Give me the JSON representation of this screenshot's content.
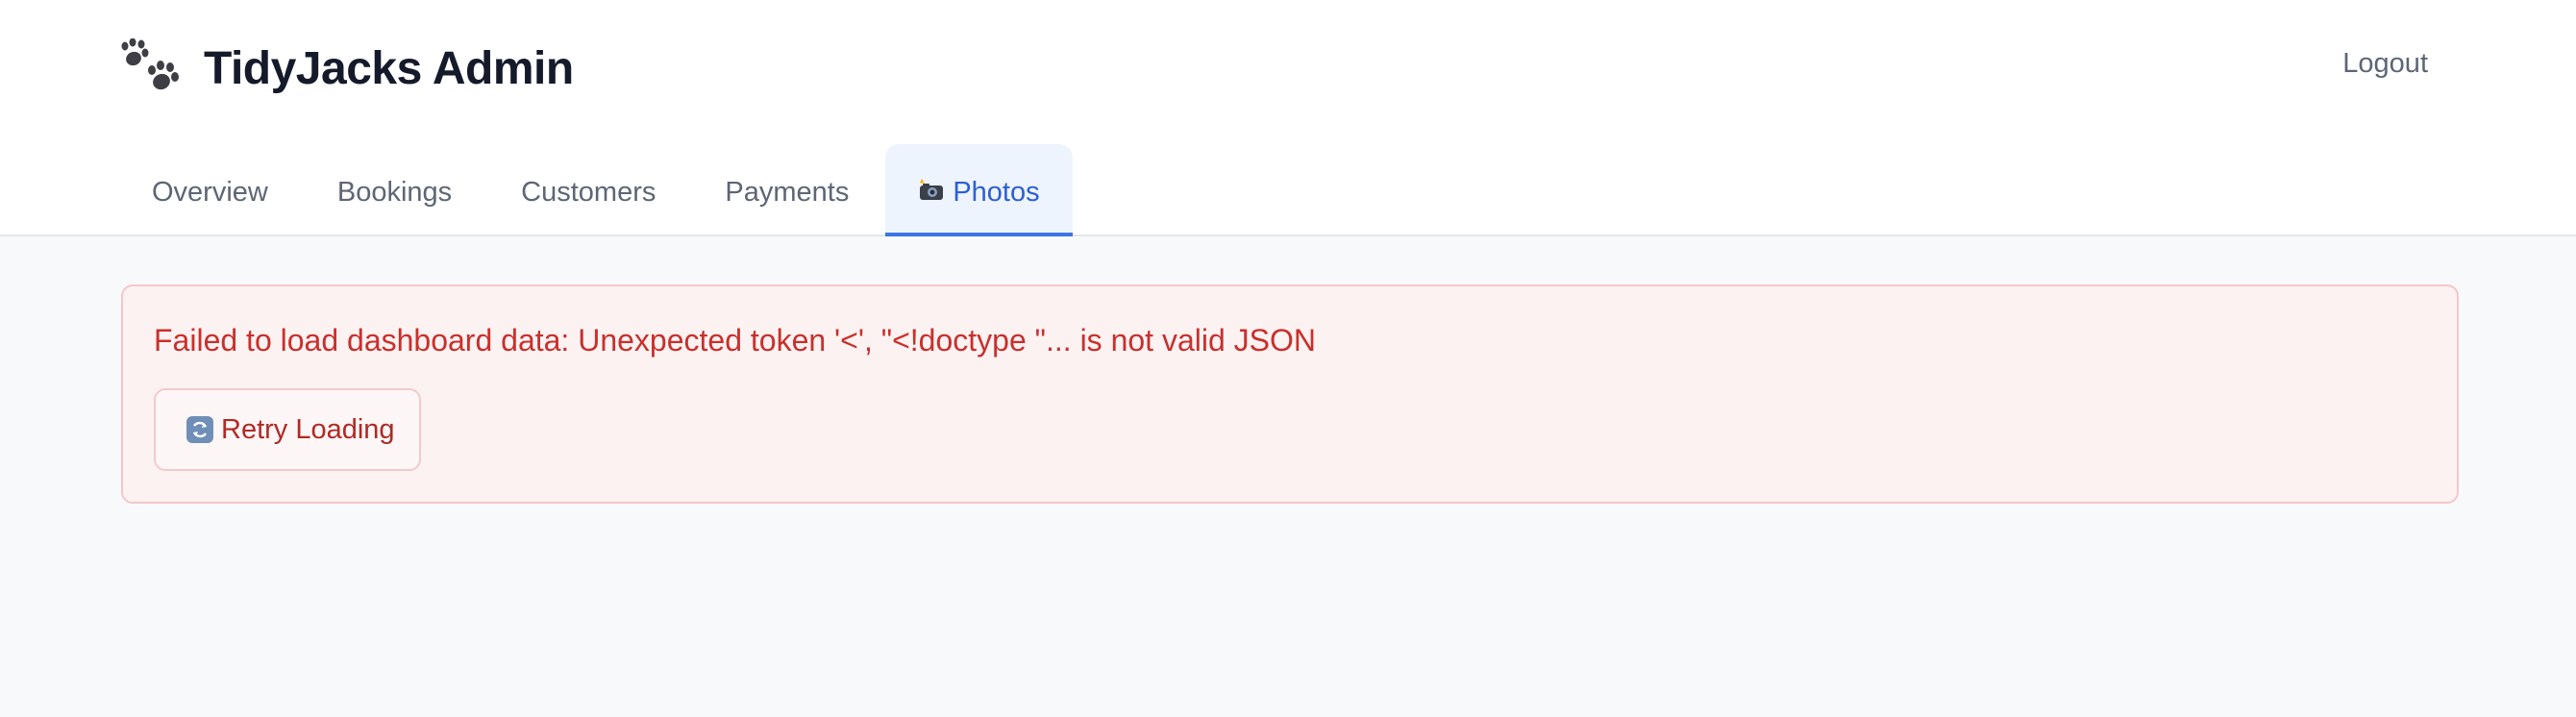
{
  "app": {
    "title": "TidyJacks Admin",
    "logo_icon": "paw-prints-icon"
  },
  "header": {
    "logout_label": "Logout"
  },
  "tabs": [
    {
      "label": "Overview",
      "active": false
    },
    {
      "label": "Bookings",
      "active": false
    },
    {
      "label": "Customers",
      "active": false
    },
    {
      "label": "Payments",
      "active": false
    },
    {
      "label": "Photos",
      "icon": "camera-flash-icon",
      "active": true
    }
  ],
  "error": {
    "message": "Failed to load dashboard data: Unexpected token '<', \"<!doctype \"... is not valid JSON",
    "retry_label": "Retry Loading",
    "retry_icon": "refresh-icon"
  },
  "colors": {
    "accent": "#2b5fd6",
    "error_text": "#c9302c",
    "error_background": "#fdf2f2",
    "error_border": "#f7c6c8"
  }
}
